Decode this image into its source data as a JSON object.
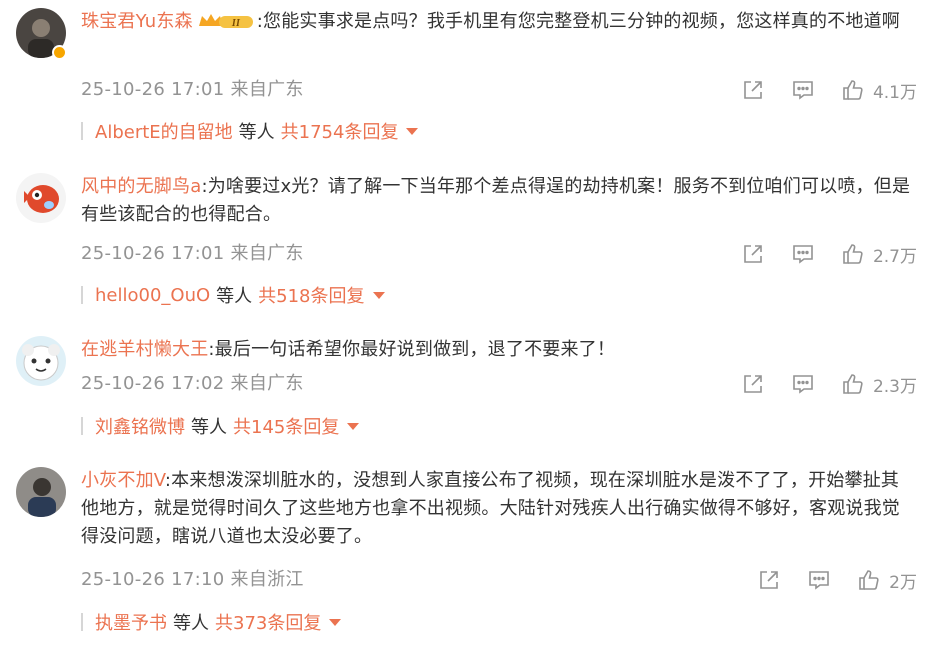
{
  "comments": [
    {
      "username": "珠宝君Yu东森",
      "text": ":您能实事求是点吗？我手机里有您完整登机三分钟的视频，您这样真的不地道啊",
      "timestamp": "25-10-26 17:01",
      "location": "来自广东",
      "likes": "4.1万",
      "vip_badge": "II",
      "verified": true,
      "replies": {
        "replier": "AlbertE的自留地",
        "mid": "等人",
        "total": "共1754条回复"
      }
    },
    {
      "username": "风中的无脚鸟a",
      "text": ":为啥要过x光？请了解一下当年那个差点得逞的劫持机案！服务不到位咱们可以喷，但是有些该配合的也得配合。",
      "timestamp": "25-10-26 17:01",
      "location": "来自广东",
      "likes": "2.7万",
      "replies": {
        "replier": "hello00_OuO",
        "mid": "等人",
        "total": "共518条回复"
      }
    },
    {
      "username": "在逃羊村懒大王",
      "text": ":最后一句话希望你最好说到做到，退了不要来了！",
      "timestamp": "25-10-26 17:02",
      "location": "来自广东",
      "likes": "2.3万",
      "replies": {
        "replier": "刘鑫铭微博",
        "mid": "等人",
        "total": "共145条回复"
      }
    },
    {
      "username": "小灰不加V",
      "text": ":本来想泼深圳脏水的，没想到人家直接公布了视频，现在深圳脏水是泼不了了，开始攀扯其他地方，就是觉得时间久了这些地方也拿不出视频。大陆针对残疾人出行确实做得不够好，客观说我觉得没问题，瞎说八道也太没必要了。",
      "timestamp": "25-10-26 17:10",
      "location": "来自浙江",
      "likes": "2万",
      "replies": {
        "replier": "执墨予书",
        "mid": "等人",
        "total": "共373条回复"
      }
    }
  ],
  "icons": {
    "share": "share-icon",
    "comment": "comment-icon",
    "like": "thumbs-up-icon",
    "expand": "caret-down-icon"
  },
  "colors": {
    "username": "#eb7350",
    "meta": "#939393",
    "text": "#333333",
    "verified": "#f7a600"
  }
}
